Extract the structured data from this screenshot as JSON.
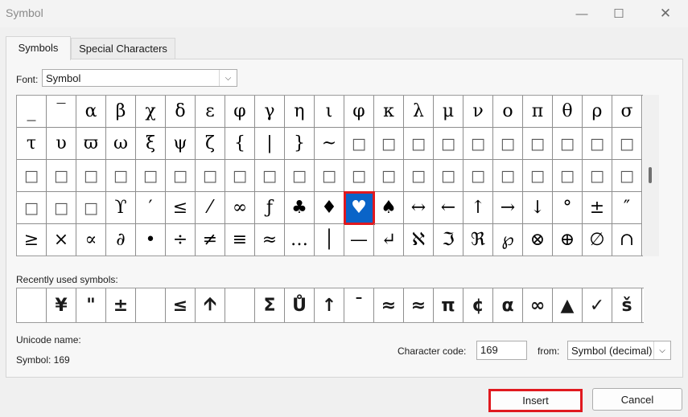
{
  "window": {
    "title": "Symbol"
  },
  "tabs": [
    {
      "label": "Symbols"
    },
    {
      "label": "Special Characters"
    }
  ],
  "font": {
    "label": "Font:",
    "value": "Symbol"
  },
  "grid": {
    "rows": [
      [
        "_",
        "‾",
        "α",
        "β",
        "χ",
        "δ",
        "ε",
        "φ",
        "γ",
        "η",
        "ι",
        "φ",
        "κ",
        "λ",
        "μ",
        "ν",
        "ο",
        "π",
        "θ",
        "ρ",
        "σ"
      ],
      [
        "τ",
        "υ",
        "ϖ",
        "ω",
        "ξ",
        "ψ",
        "ζ",
        "{",
        "|",
        "}",
        "~",
        "□",
        "□",
        "□",
        "□",
        "□",
        "□",
        "□",
        "□",
        "□",
        "□"
      ],
      [
        "□",
        "□",
        "□",
        "□",
        "□",
        "□",
        "□",
        "□",
        "□",
        "□",
        "□",
        "□",
        "□",
        "□",
        "□",
        "□",
        "□",
        "□",
        "□",
        "□",
        "□"
      ],
      [
        "□",
        "□",
        "□",
        "ϒ",
        "′",
        "≤",
        "⁄",
        "∞",
        "ƒ",
        "♣",
        "♦",
        "♥",
        "♠",
        "↔",
        "←",
        "↑",
        "→",
        "↓",
        "°",
        "±",
        "″"
      ],
      [
        "≥",
        "×",
        "∝",
        "∂",
        "•",
        "÷",
        "≠",
        "≡",
        "≈",
        "…",
        "│",
        "—",
        "↵",
        "ℵ",
        "ℑ",
        "ℜ",
        "℘",
        "⊗",
        "⊕",
        "∅",
        "∩"
      ]
    ],
    "selected": {
      "row": 3,
      "col": 11
    }
  },
  "recent": {
    "label": "Recently used symbols:",
    "items": [
      "",
      "¥",
      "\"",
      "±",
      "",
      "≤",
      "🡩",
      "",
      "Σ",
      "Ů",
      "↑",
      "¯",
      "≈",
      "≈",
      "π",
      "¢",
      "α",
      "∞",
      "▲",
      "✓",
      "š"
    ]
  },
  "unicode_name": {
    "label": "Unicode name:",
    "value": "Symbol: 169"
  },
  "character_code": {
    "label": "Character code:",
    "value": "169"
  },
  "from": {
    "label": "from:",
    "value": "Symbol (decimal)"
  },
  "buttons": {
    "insert": "Insert",
    "cancel": "Cancel"
  },
  "colors": {
    "selection": "#0a64c8",
    "highlight": "#e0191f"
  },
  "icons": {
    "minimize": "minimize-icon",
    "maximize": "maximize-icon",
    "close": "close-icon",
    "dropdown": "chevron-down-icon"
  }
}
